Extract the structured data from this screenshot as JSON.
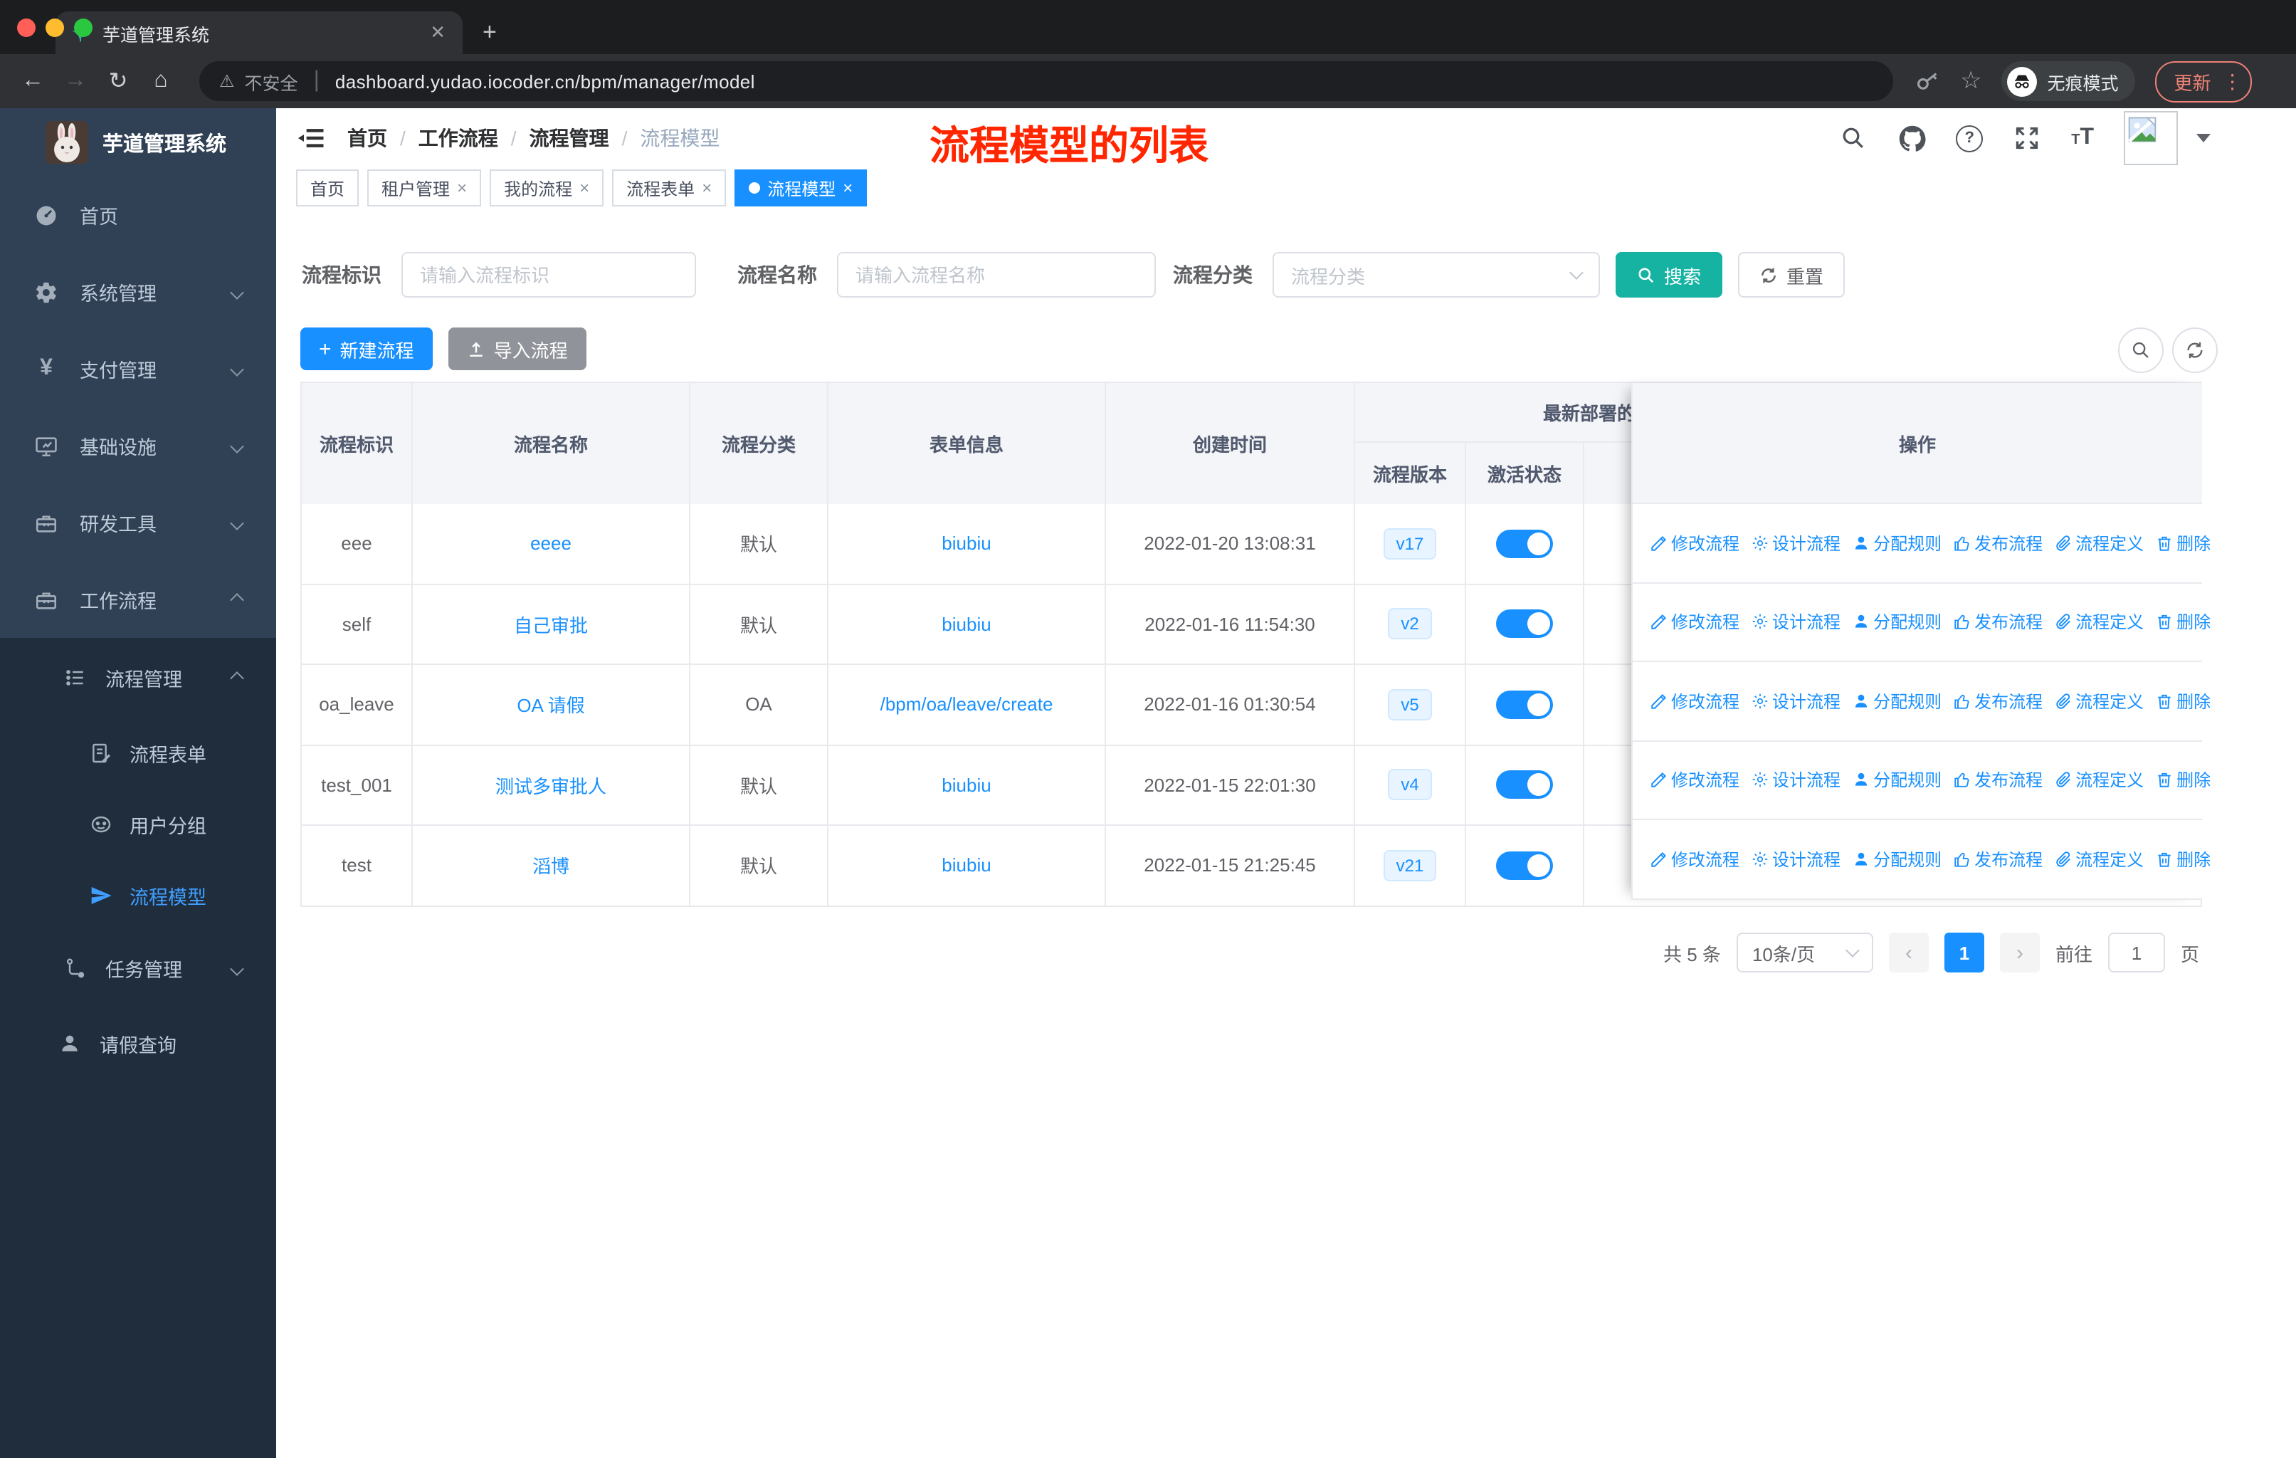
{
  "browser": {
    "tab_title": "芋道管理系统",
    "security_warning": "不安全",
    "url": "dashboard.yudao.iocoder.cn/bpm/manager/model",
    "incognito_label": "无痕模式",
    "update_label": "更新"
  },
  "sidebar": {
    "app_title": "芋道管理系统",
    "menu": {
      "home": "首页",
      "system": "系统管理",
      "payment": "支付管理",
      "infra": "基础设施",
      "devtools": "研发工具",
      "workflow": "工作流程",
      "process_mgmt": "流程管理",
      "process_form": "流程表单",
      "user_group": "用户分组",
      "process_model": "流程模型",
      "task_mgmt": "任务管理",
      "leave_query": "请假查询"
    }
  },
  "navbar": {
    "breadcrumb": [
      "首页",
      "工作流程",
      "流程管理",
      "流程模型"
    ],
    "annotation": "流程模型的列表"
  },
  "tags": [
    {
      "label": "首页",
      "closable": false,
      "active": false
    },
    {
      "label": "租户管理",
      "closable": true,
      "active": false
    },
    {
      "label": "我的流程",
      "closable": true,
      "active": false
    },
    {
      "label": "流程表单",
      "closable": true,
      "active": false
    },
    {
      "label": "流程模型",
      "closable": true,
      "active": true
    }
  ],
  "filters": {
    "key_label": "流程标识",
    "key_placeholder": "请输入流程标识",
    "name_label": "流程名称",
    "name_placeholder": "请输入流程名称",
    "category_label": "流程分类",
    "category_placeholder": "流程分类",
    "search_label": "搜索",
    "reset_label": "重置"
  },
  "toolbar": {
    "create_label": "新建流程",
    "import_label": "导入流程"
  },
  "table": {
    "headers": {
      "key": "流程标识",
      "name": "流程名称",
      "category": "流程分类",
      "form": "表单信息",
      "created": "创建时间",
      "deploy_group": "最新部署的",
      "version": "流程版本",
      "status": "激活状态",
      "ops": "操作"
    },
    "rows": [
      {
        "key": "eee",
        "name": "eeee",
        "category": "默认",
        "form": "biubiu",
        "created": "2022-01-20 13:08:31",
        "version": "v17",
        "active": true
      },
      {
        "key": "self",
        "name": "自己审批",
        "category": "默认",
        "form": "biubiu",
        "created": "2022-01-16 11:54:30",
        "version": "v2",
        "active": true
      },
      {
        "key": "oa_leave",
        "name": "OA 请假",
        "category": "OA",
        "form": "/bpm/oa/leave/create",
        "created": "2022-01-16 01:30:54",
        "version": "v5",
        "active": true
      },
      {
        "key": "test_001",
        "name": "测试多审批人",
        "category": "默认",
        "form": "biubiu",
        "created": "2022-01-15 22:01:30",
        "version": "v4",
        "active": true
      },
      {
        "key": "test",
        "name": "滔博",
        "category": "默认",
        "form": "biubiu",
        "created": "2022-01-15 21:25:45",
        "version": "v21",
        "active": true
      }
    ],
    "row_actions": [
      "修改流程",
      "设计流程",
      "分配规则",
      "发布流程",
      "流程定义",
      "删除"
    ]
  },
  "pagination": {
    "total": "共 5 条",
    "page_size": "10条/页",
    "page": "1",
    "goto_label": "前往",
    "goto_value": "1",
    "page_unit": "页"
  },
  "colors": {
    "primary": "#1890ff",
    "teal_search": "#16b3a3",
    "sidebar_bg": "#304156",
    "submenu_bg": "#1f2d3d",
    "active_menu": "#409eff",
    "annotation_red": "#ff2600"
  }
}
